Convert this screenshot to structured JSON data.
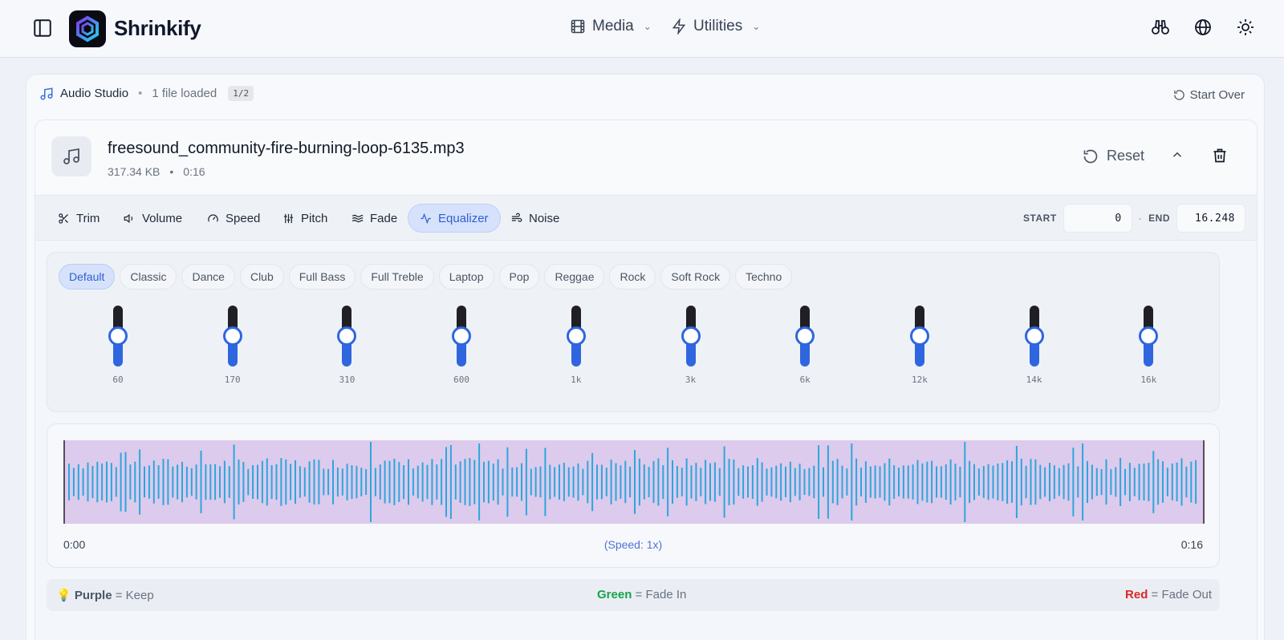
{
  "app": {
    "name": "Shrinkify"
  },
  "nav": {
    "media": "Media",
    "utilities": "Utilities"
  },
  "studio": {
    "title": "Audio Studio",
    "status": "1 file loaded",
    "badge": "1/2",
    "start_over": "Start Over"
  },
  "file": {
    "name": "freesound_community-fire-burning-loop-6135.mp3",
    "size": "317.34 KB",
    "duration": "0:16",
    "reset": "Reset"
  },
  "tools": [
    {
      "label": "Trim",
      "icon": "scissors-icon"
    },
    {
      "label": "Volume",
      "icon": "speaker-icon"
    },
    {
      "label": "Speed",
      "icon": "gauge-icon"
    },
    {
      "label": "Pitch",
      "icon": "sliders-icon"
    },
    {
      "label": "Fade",
      "icon": "waves-icon"
    },
    {
      "label": "Equalizer",
      "icon": "activity-icon",
      "active": true
    },
    {
      "label": "Noise",
      "icon": "wind-icon"
    }
  ],
  "range": {
    "start_label": "START",
    "start_value": "0",
    "end_label": "END",
    "end_value": "16.248",
    "dash": "-"
  },
  "presets": [
    "Default",
    "Classic",
    "Dance",
    "Club",
    "Full Bass",
    "Full Treble",
    "Laptop",
    "Pop",
    "Reggae",
    "Rock",
    "Soft Rock",
    "Techno"
  ],
  "active_preset": "Default",
  "bands": [
    {
      "label": "60",
      "level": 0.5
    },
    {
      "label": "170",
      "level": 0.5
    },
    {
      "label": "310",
      "level": 0.5
    },
    {
      "label": "600",
      "level": 0.5
    },
    {
      "label": "1k",
      "level": 0.5
    },
    {
      "label": "3k",
      "level": 0.5
    },
    {
      "label": "6k",
      "level": 0.5
    },
    {
      "label": "12k",
      "level": 0.5
    },
    {
      "label": "14k",
      "level": 0.5
    },
    {
      "label": "16k",
      "level": 0.5
    }
  ],
  "waveform": {
    "start_time": "0:00",
    "end_time": "0:16",
    "speed": "(Speed: 1x)",
    "region_color": "#dccbec",
    "bar_color": "#2ea6dc"
  },
  "legend": {
    "purple": "Purple",
    "keep": "= Keep",
    "green": "Green",
    "fade_in": "= Fade In",
    "red": "Red",
    "fade_out": "= Fade Out",
    "purple_color": "#4b5563",
    "green_color": "#16a34a",
    "red_color": "#dc2626"
  }
}
